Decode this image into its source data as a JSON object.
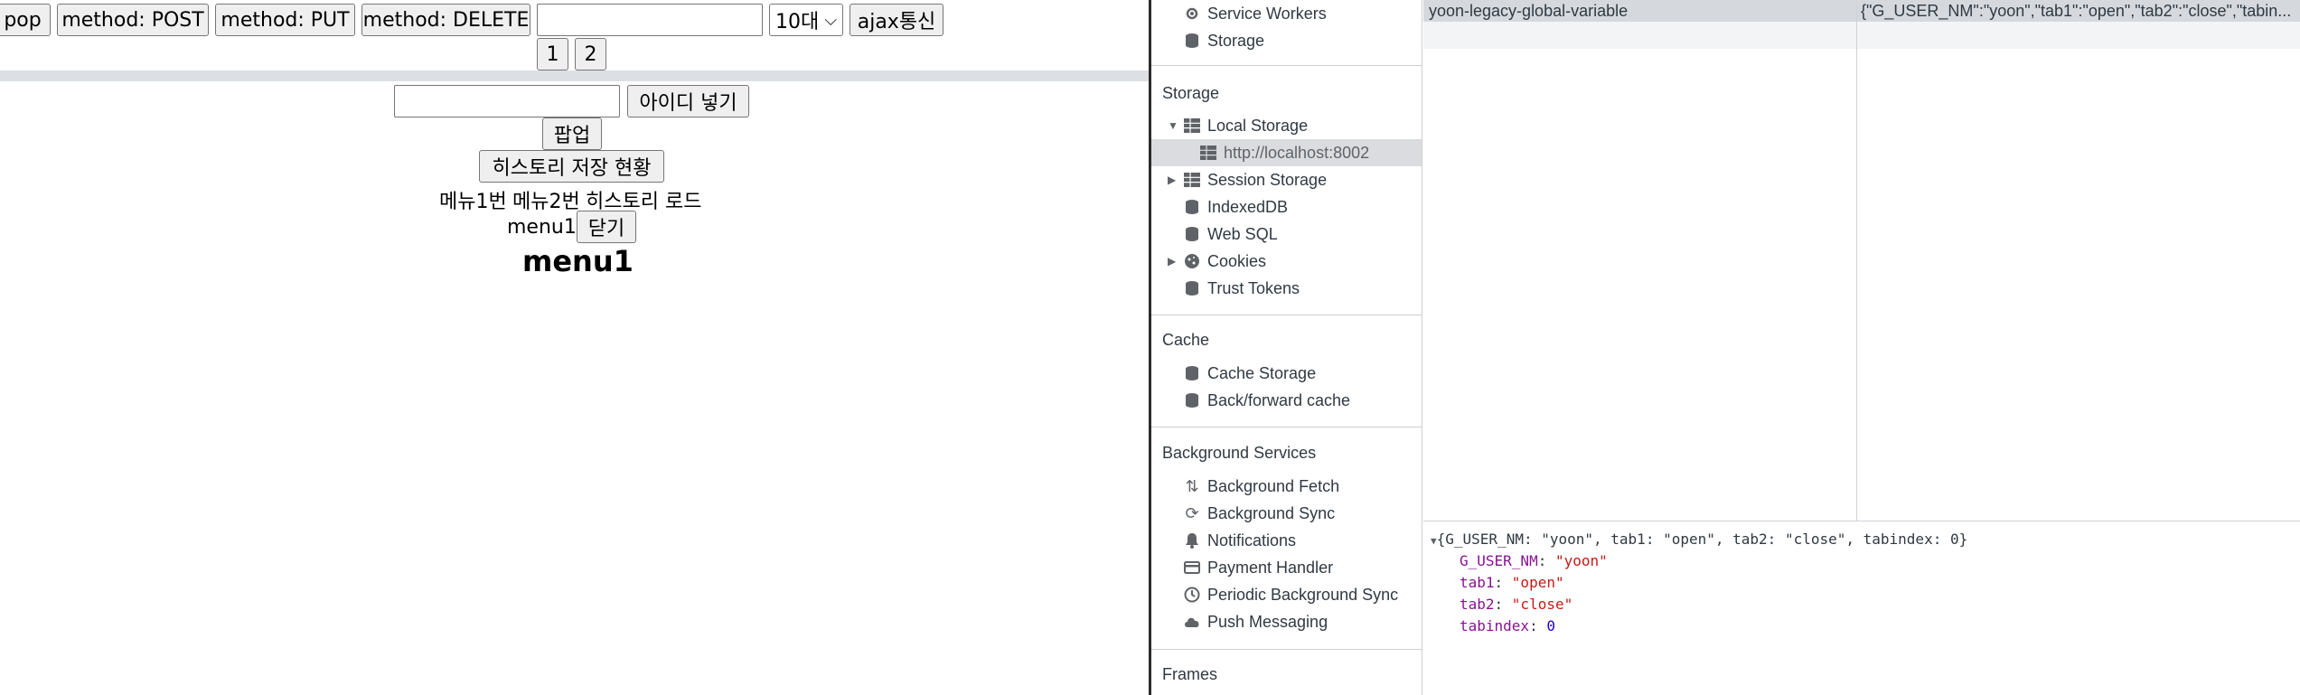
{
  "page": {
    "buttons_row1": {
      "pop": "pop",
      "post": "method: POST",
      "put": "method: PUT",
      "delete": "method: DELETE"
    },
    "text_input_value": "",
    "age_select": {
      "selected": "10대",
      "caret": "⌵"
    },
    "ajax_button": "ajax통신",
    "page_buttons": [
      "1",
      "2"
    ],
    "id_input_value": "",
    "add_id_button": "아이디 넣기",
    "popup_button": "팝업",
    "history_status_button": "히스토리 저장 현황",
    "links": {
      "menu1": "메뉴1번",
      "menu2": "메뉴2번",
      "history_load": "히스토리 로드"
    },
    "menu_label": "menu1",
    "close_button": "닫기",
    "heading": "menu1"
  },
  "devtools": {
    "sidebar": {
      "top_items": [
        "Service Workers",
        "Storage"
      ],
      "storage_header": "Storage",
      "local_storage": "Local Storage",
      "local_origin": "http://localhost:8002",
      "session_storage": "Session Storage",
      "indexeddb": "IndexedDB",
      "websql": "Web SQL",
      "cookies": "Cookies",
      "trust_tokens": "Trust Tokens",
      "cache_header": "Cache",
      "cache_items": [
        "Cache Storage",
        "Back/forward cache"
      ],
      "bg_header": "Background Services",
      "bg_items": [
        "Background Fetch",
        "Background Sync",
        "Notifications",
        "Payment Handler",
        "Periodic Background Sync",
        "Push Messaging"
      ],
      "frames_header": "Frames"
    },
    "table": {
      "key": "yoon-legacy-global-variable",
      "value": "{\"G_USER_NM\":\"yoon\",\"tab1\":\"open\",\"tab2\":\"close\",\"tabin..."
    },
    "preview": {
      "summary": "{G_USER_NM: \"yoon\", tab1: \"open\", tab2: \"close\", tabindex: 0}",
      "props": [
        {
          "key": "G_USER_NM",
          "value": "\"yoon\"",
          "kind": "string"
        },
        {
          "key": "tab1",
          "value": "\"open\"",
          "kind": "string"
        },
        {
          "key": "tab2",
          "value": "\"close\"",
          "kind": "string"
        },
        {
          "key": "tabindex",
          "value": "0",
          "kind": "number"
        }
      ]
    }
  },
  "colors": {
    "selected_row": "#d5d9de",
    "key_purple": "#881391",
    "string_red": "#c41a16",
    "number_blue": "#1c00cf"
  }
}
